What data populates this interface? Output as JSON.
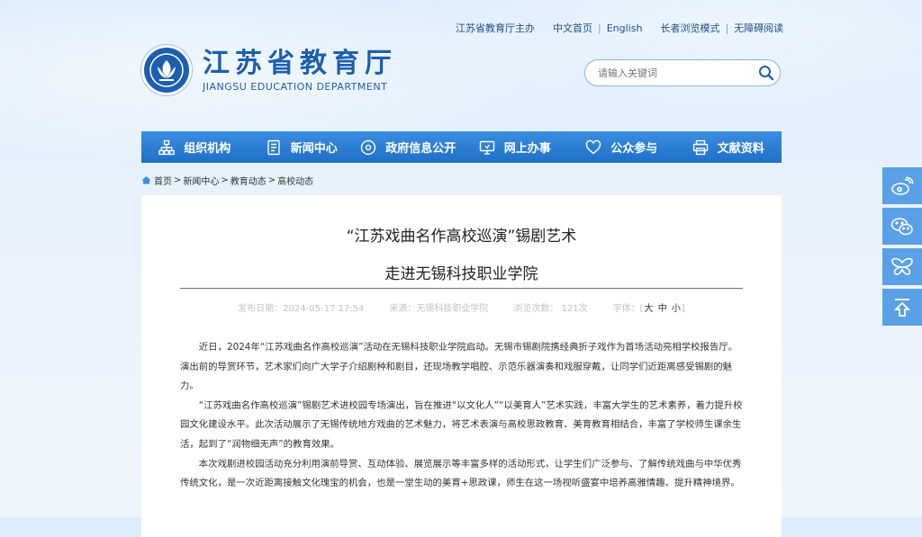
{
  "top_links": {
    "host": "江苏省教育厅主办",
    "cn_home": "中文首页",
    "english": "English",
    "elder_mode": "长者浏览模式",
    "barrier_free": "无障碍阅读"
  },
  "logo": {
    "cn": "江苏省教育厅",
    "en": "JIANGSU EDUCATION DEPARTMENT"
  },
  "search": {
    "placeholder": "请输入关键词"
  },
  "nav": [
    {
      "label": "组织机构",
      "icon": "org-chart-icon"
    },
    {
      "label": "新闻中心",
      "icon": "news-icon"
    },
    {
      "label": "政府信息公开",
      "icon": "eye-icon"
    },
    {
      "label": "网上办事",
      "icon": "monitor-icon"
    },
    {
      "label": "公众参与",
      "icon": "heart-icon"
    },
    {
      "label": "文献资料",
      "icon": "print-icon"
    }
  ],
  "breadcrumb": [
    "首页",
    "新闻中心",
    "教育动态",
    "高校动态"
  ],
  "article": {
    "title_line1": "“江苏戏曲名作高校巡演”锡剧艺术",
    "title_line2": "走进无锡科技职业学院",
    "date": "发布日期：2024-05-17 17:54",
    "source": "来源：无锡科技职业学院",
    "views": "浏览次数： 121次",
    "font_label": "字体：",
    "font_large": "大",
    "font_medium": "中",
    "font_small": "小",
    "paragraphs": [
      "近日，2024年“江苏戏曲名作高校巡演”活动在无锡科技职业学院启动。无锡市锡剧院携经典折子戏作为首场活动亮相学校报告厅。演出前的导赏环节，艺术家们向广大学子介绍剧种和剧目，还现场教学唱腔、示范乐器演奏和戏服穿戴，让同学们近距离感受锡剧的魅力。",
      "“江苏戏曲名作高校巡演”锡剧艺术进校园专场演出，旨在推进“以文化人”“以美育人”艺术实践，丰富大学生的艺术素养，着力提升校园文化建设水平。此次活动展示了无锡传统地方戏曲的艺术魅力，将艺术表演与高校思政教育、美育教育相结合，丰富了学校师生课余生活，起到了“润物细无声”的教育效果。",
      "本次戏剧进校园活动充分利用演前导赏、互动体验、展览展示等丰富多样的活动形式，让学生们广泛参与、了解传统戏曲与中华优秀传统文化，是一次近距离接触文化瑰宝的机会，也是一堂生动的美育+思政课，师生在这一场视听盛宴中培养高雅情趣、提升精神境界。"
    ]
  },
  "float_bar": [
    "weibo-icon",
    "wechat-icon",
    "butterfly-icon",
    "back-to-top-icon"
  ],
  "colors": {
    "nav_blue": "#1f6fc7",
    "brand_blue": "#1d5fae",
    "float_blue": "#5aa0e6"
  }
}
